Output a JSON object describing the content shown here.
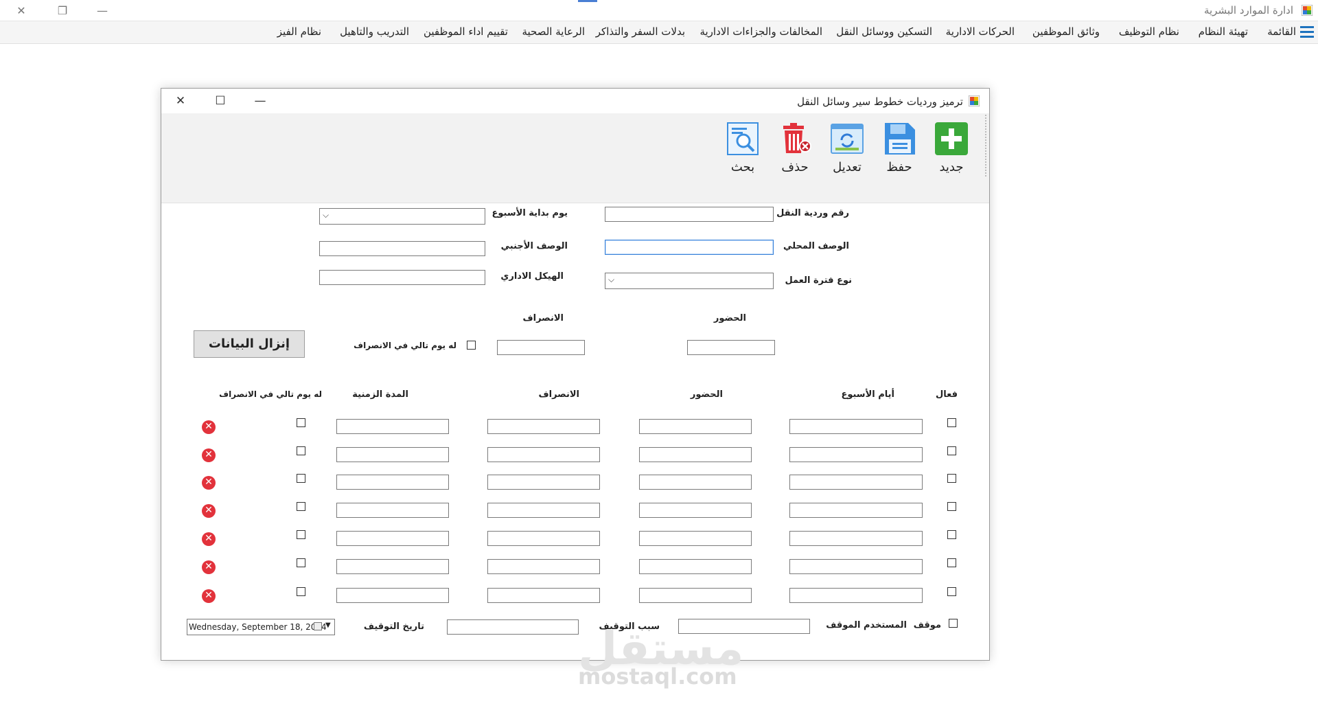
{
  "app": {
    "title": "ادارة الموارد البشرية"
  },
  "menu": {
    "items": [
      "القائمة",
      "تهيئة النظام",
      "نظام التوظيف",
      "وثائق الموظفين",
      "الحركات الادارية",
      "التسكين ووسائل النقل",
      "المخالفات والجزاءات الادارية",
      "بدلات السفر والتذاكر",
      "الرعاية الصحية",
      "تقييم اداء الموظفين",
      "التدريب والتاهيل",
      "نظام الفيز"
    ]
  },
  "dialog": {
    "title": "ترميز ورديات خطوط سير وسائل النقل",
    "toolbar": {
      "new": "جديد",
      "save": "حفظ",
      "edit": "تعديل",
      "delete": "حذف",
      "search": "بحث"
    },
    "form": {
      "shift_no": "رقم وردية النقل",
      "week_start": "يوم بداية الأسبوع",
      "local_desc": "الوصف المحلي",
      "foreign_desc": "الوصف الأجنبي",
      "work_period_type": "نوع فترة العمل",
      "admin_structure": "الهيكل الاداري"
    },
    "times": {
      "attendance": "الحضور",
      "departure": "الانصراف",
      "next_day": "له يوم تالي في الانصراف",
      "download_button": "إنزال البيانات"
    },
    "grid": {
      "headers": {
        "active": "فعال",
        "weekdays": "أيام الأسبوع",
        "attendance": "الحضور",
        "departure": "الانصراف",
        "duration": "المدة الزمنية",
        "next_day": "له يوم تالي في الانصراف"
      },
      "row_count": 7
    },
    "footer": {
      "stopped": "موقف",
      "stopping_user": "المستخدم الموقف",
      "stop_reason": "سبب التوقيف",
      "stop_date": "تاريخ التوقيف",
      "stop_date_value": "Wednesday, September 18, 2024"
    }
  },
  "watermark": {
    "arabic": "مستقل",
    "latin": "mostaql.com"
  },
  "colors": {
    "accent": "#2f7bd7",
    "delete": "#e2323b",
    "new": "#3aa83a"
  }
}
